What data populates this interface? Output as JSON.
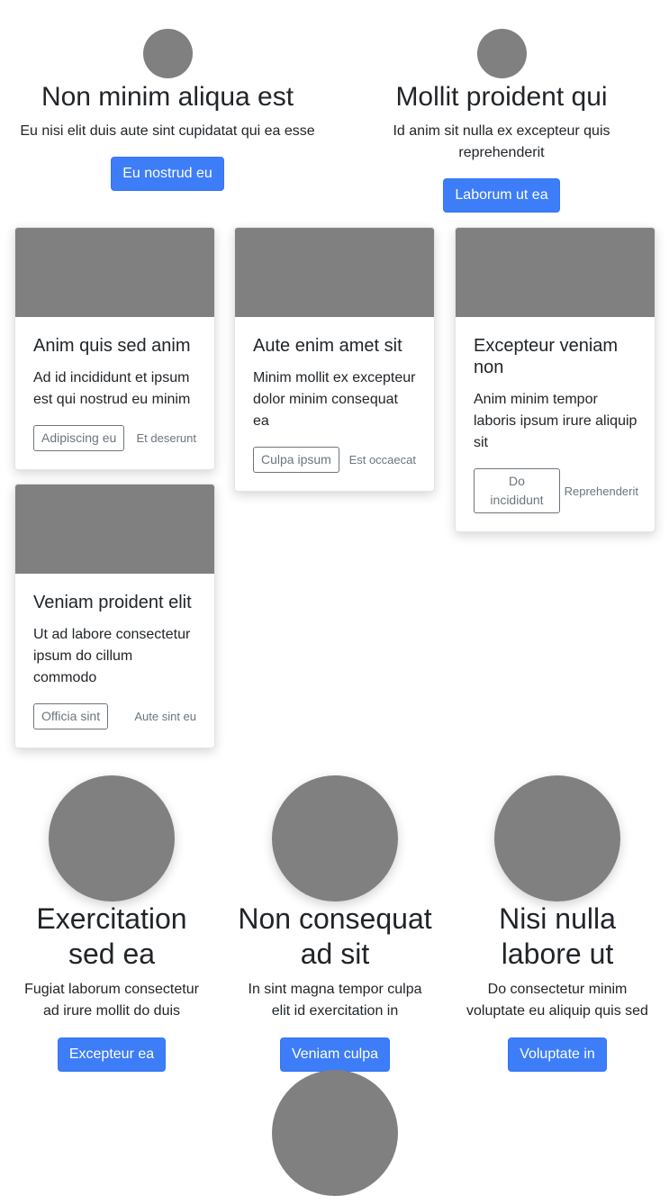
{
  "top_features": [
    {
      "title": "Non minim aliqua est",
      "text": "Eu nisi elit duis aute sint cupidatat qui ea esse",
      "button": "Eu nostrud eu"
    },
    {
      "title": "Mollit proident qui",
      "text": "Id anim sit nulla ex excepteur quis reprehenderit",
      "button": "Laborum ut ea"
    }
  ],
  "cards": [
    {
      "title": "Anim quis sed anim",
      "text": "Ad id incididunt et ipsum est qui nostrud eu minim",
      "button": "Adipiscing eu",
      "meta": "Et deserunt"
    },
    {
      "title": "Aute enim amet sit",
      "text": "Minim mollit ex excepteur dolor minim consequat ea",
      "button": "Culpa ipsum",
      "meta": "Est occaecat"
    },
    {
      "title": "Excepteur veniam non",
      "text": "Anim minim tempor laboris ipsum irure aliquip sit",
      "button": "Do incididunt",
      "meta": "Reprehenderit"
    },
    {
      "title": "Veniam proident elit",
      "text": "Ut ad labore consectetur ipsum do cillum commodo",
      "button": "Officia sint",
      "meta": "Aute sint eu"
    }
  ],
  "bottom_features": [
    {
      "title": "Exercitation sed ea",
      "text": "Fugiat laborum consectetur ad irure mollit do duis",
      "button": "Excepteur ea"
    },
    {
      "title": "Non consequat ad sit",
      "text": "In sint magna tempor culpa elit id exercitation in",
      "button": "Veniam culpa"
    },
    {
      "title": "Nisi nulla labore ut",
      "text": "Do consectetur minim voluptate eu aliquip quis sed",
      "button": "Voluptate in"
    }
  ],
  "colors": {
    "primary": "#3d7df8",
    "placeholder": "#808080",
    "muted": "#6c757d"
  }
}
